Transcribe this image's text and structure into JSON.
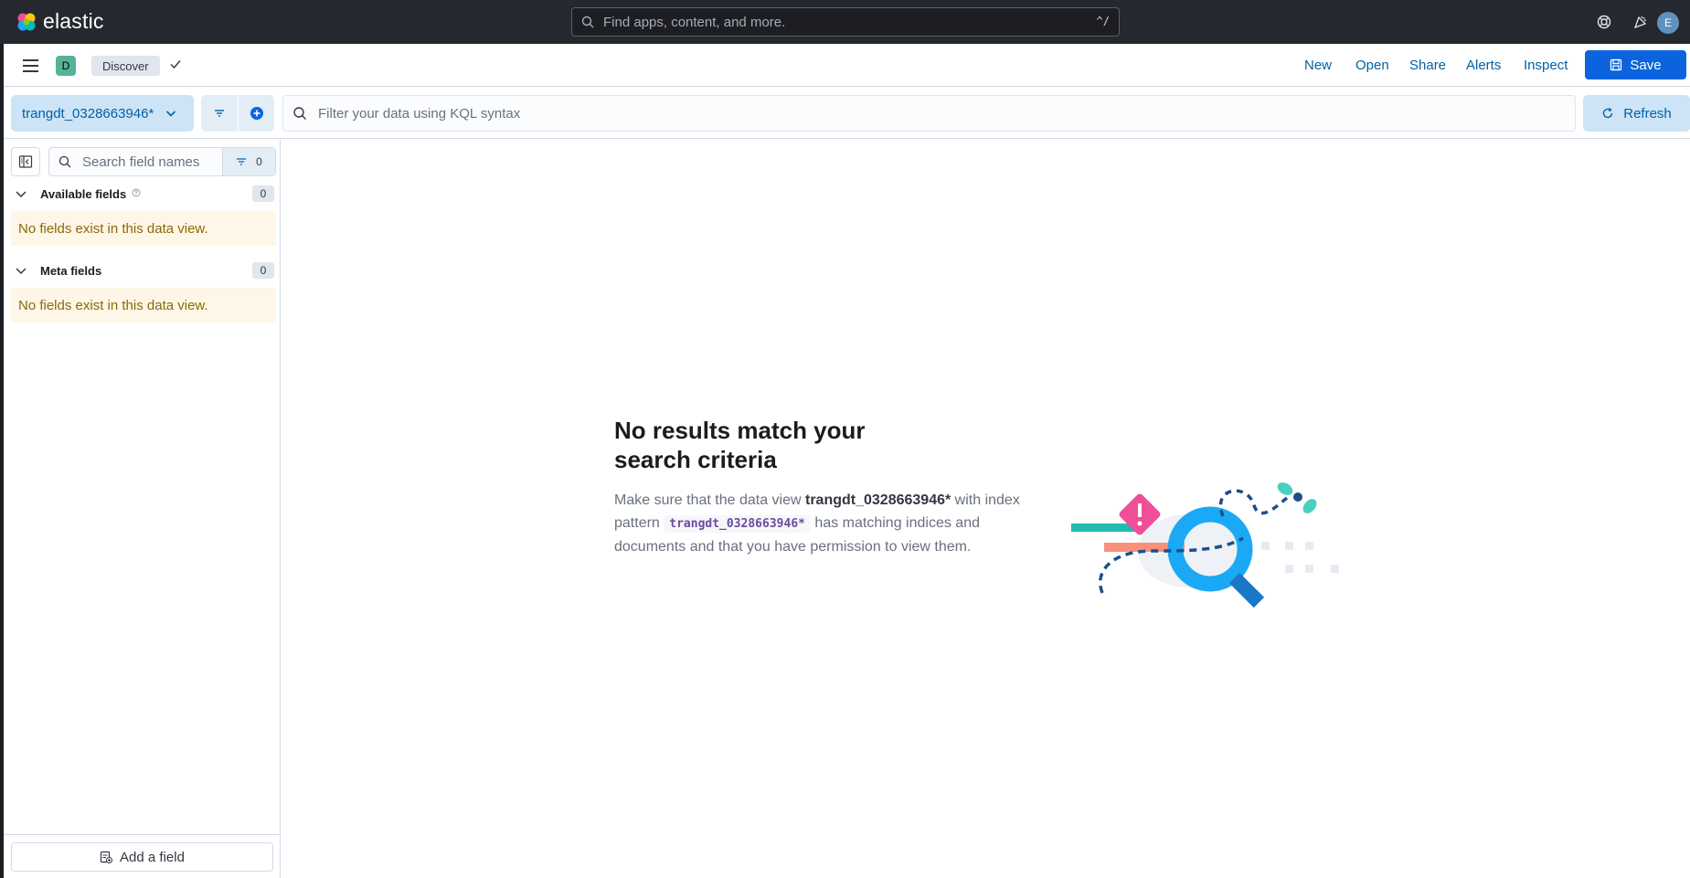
{
  "header": {
    "logo_text": "elastic",
    "search_placeholder": "Find apps, content, and more.",
    "search_shortcut": "^/",
    "avatar_initial": "E"
  },
  "app_bar": {
    "app_badge": "D",
    "breadcrumb": "Discover",
    "links": [
      "New",
      "Open",
      "Share",
      "Alerts",
      "Inspect"
    ],
    "save_label": "Save"
  },
  "query_bar": {
    "data_view": "trangdt_0328663946*",
    "kql_placeholder": "Filter your data using KQL syntax",
    "refresh_label": "Refresh"
  },
  "sidebar": {
    "search_placeholder": "Search field names",
    "filter_count": "0",
    "available": {
      "title": "Available fields",
      "count": "0",
      "empty_text": "No fields exist in this data view."
    },
    "meta": {
      "title": "Meta fields",
      "count": "0",
      "empty_text": "No fields exist in this data view."
    },
    "add_field_label": "Add a field"
  },
  "empty_state": {
    "title": "No results match your search criteria",
    "body_1": "Make sure that the data view ",
    "data_view": "trangdt_0328663946*",
    "body_2": " with index pattern ",
    "pattern": "trangdt_0328663946*",
    "body_3": " has matching indices and documents and that you have permission to view them."
  },
  "colors": {
    "header_bg": "#25282f",
    "primary": "#0b64dd",
    "link": "#0061a6",
    "light_primary": "#cce4f5",
    "warning_bg": "#fef6e6"
  }
}
